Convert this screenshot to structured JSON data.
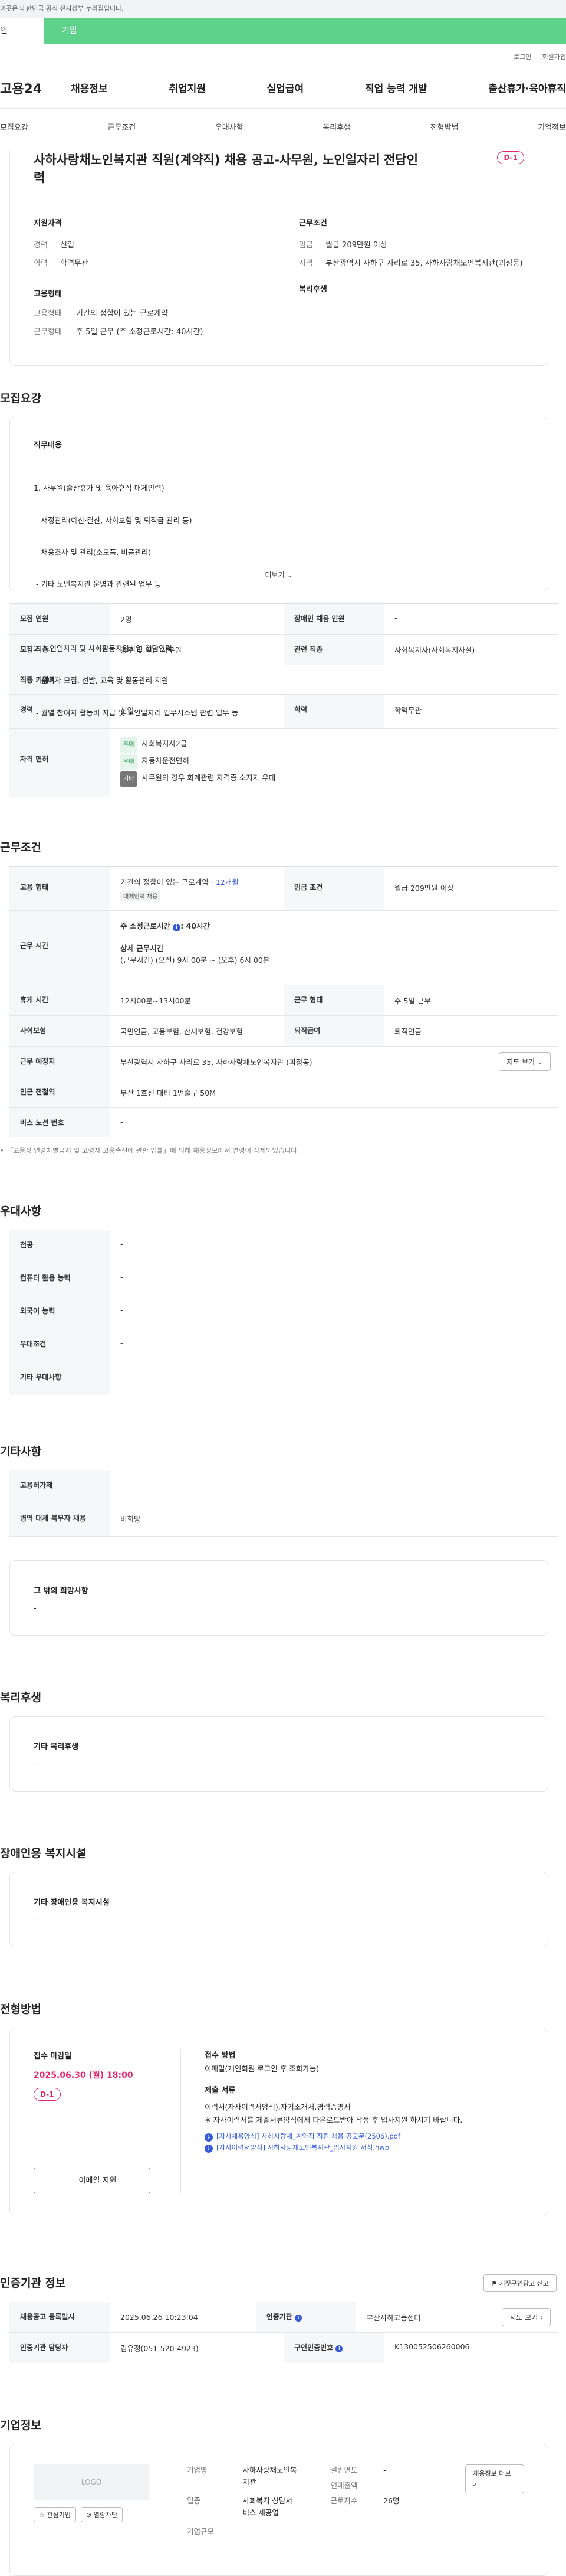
{
  "gov_banner": "이곳은 대한민국 공식 전자정부 누리집입니다.",
  "tabs": [
    "인",
    "기업"
  ],
  "util": [
    "로그인",
    "회원가입"
  ],
  "logo": "고용24",
  "gnb": [
    "채용정보",
    "취업지원",
    "실업급여",
    "직업 능력 개발",
    "출산휴가·육아휴직"
  ],
  "subnav": [
    "모집요강",
    "근무조건",
    "우대사항",
    "복리후생",
    "전형방법",
    "기업정보"
  ],
  "job": {
    "title_line1": "사하사랑채노인복지관 직원(계약직) 채용 공고-사무원, 노인일자리 전담인",
    "title_line2": "력",
    "dday": "D-1",
    "qual_title": "지원자격",
    "qual": [
      {
        "k": "경력",
        "v": "신입"
      },
      {
        "k": "학력",
        "v": "학력무관"
      }
    ],
    "cond_title": "근무조건",
    "cond": [
      {
        "k": "임금",
        "v": "월급 209만원 이상"
      },
      {
        "k": "지역",
        "v": "부산광역시 사하구 사리로 35, 사하사랑채노인복지관(괴정동)"
      }
    ],
    "emp_title": "고용형태",
    "emp": [
      {
        "k": "고용형태",
        "v": "기간의 정함이 있는 근로계약"
      },
      {
        "k": "근무형태",
        "v": "주 5일 근무 (주 소정근로시간: 40시간)"
      }
    ],
    "welfare_title": "복리후생"
  },
  "recruit": {
    "section": "모집요강",
    "duty_title": "직무내용",
    "duty_lines": [
      "1. 사무원(출산휴가 및 육아휴직 대체인력)",
      " - 재정관리(예산·결산, 사회보험 및 퇴직금 관리 등)",
      " - 채용조사 및 관리(소모품, 비품관리)",
      " - 기타 노인복지관 운영과 관련된 업무 등",
      "",
      "2. 노인일자리 및 사회활동지원사업 전담인력",
      " - 참여자 모집, 선발, 교육 및 활동관리 지원",
      " - 월별 참여자 활동비 지급 및 노인일자리 업무시스템 관련 업무 등"
    ],
    "more": "더보기",
    "rows": [
      {
        "h": "모집 인원",
        "v": "2명",
        "h2": "장애인 채용 인원",
        "v2": "-"
      },
      {
        "h": "모집 직종",
        "v": "총무 및 일반 사무원",
        "h2": "관련 직종",
        "v2": "사회복지사(사회복지사설)"
      },
      {
        "h": "직종 키워드",
        "v": "-"
      },
      {
        "h": "경력",
        "v": "신입",
        "h2": "학력",
        "v2": "학력무관"
      }
    ],
    "license_label": "자격 면허",
    "licenses": [
      {
        "tag": "우대",
        "name": "사회복지사2급"
      },
      {
        "tag": "우대",
        "name": "자동차운전면허"
      },
      {
        "tag": "기타",
        "name": "사무원의 경우 회계관련 자격증 소지자 우대"
      }
    ]
  },
  "work": {
    "section": "근무조건",
    "emp_h": "고용 형태",
    "emp_v": "기간의 정함이 있는 근로계약 · ",
    "emp_months": "12개월",
    "emp_tag": "대체인력 채용",
    "wage_h": "임금 조건",
    "wage_v": "월급 209만원 이상",
    "hours_h": "근무 시간",
    "hours_week": "주 소정근로시간",
    "hours_week_v": ": 40시간",
    "hours_detail_t": "상세 근무시간",
    "hours_detail_v": "(근무시간) (오전) 9시 00분 ~ (오후) 6시 00분",
    "break_h": "휴게 시간",
    "break_v": "12시00분~13시00분",
    "type_h": "근무 형태",
    "type_v": "주 5일 근무",
    "ins_h": "사회보험",
    "ins_v": "국민연금, 고용보험, 산재보험, 건강보험",
    "ret_h": "퇴직급여",
    "ret_v": "퇴직연금",
    "place_h": "근무 예정지",
    "place_v": "부산광역시 사하구 사리로 35, 사하사랑채노인복지관 (괴정동)",
    "map_btn": "지도 보기",
    "subway_h": "인근 전철역",
    "subway_v": "부산 1호선 대티 1번출구 50M",
    "bus_h": "버스 노선 번호",
    "bus_v": "-",
    "note": "• 「고용상 연령차별금지 및 고령자 고용촉진에 관한 법률」에 의해 채용정보에서 연령이 삭제되었습니다."
  },
  "pref": {
    "section": "우대사항",
    "rows": [
      {
        "h": "전공",
        "v": "-"
      },
      {
        "h": "컴퓨터 활용 능력",
        "v": "-"
      },
      {
        "h": "외국어 능력",
        "v": "-"
      },
      {
        "h": "우대조건",
        "v": "-"
      },
      {
        "h": "기타 우대사항",
        "v": "-"
      }
    ]
  },
  "etc": {
    "section": "기타사항",
    "rows": [
      {
        "h": "고용허가제",
        "v": "-"
      },
      {
        "h": "병역 대체 복무자 채용",
        "v": "비희망"
      }
    ],
    "box_title": "그 밖의 희망사항",
    "box_v": "-"
  },
  "welfare": {
    "section": "복리후생",
    "box_title": "기타 복리후생",
    "box_v": "-"
  },
  "disab": {
    "section": "장애인용 복지시설",
    "box_title": "기타 장애인용 복지시설",
    "box_v": "-"
  },
  "process": {
    "section": "전형방법",
    "deadline_t": "접수 마감일",
    "deadline_v": "2025.06.30 (월) 18:00",
    "dday": "D-1",
    "email_btn": "이메일 지원",
    "method_t": "접수 방법",
    "method_v": "이메일(개인회원 로그인 후 조회가능)",
    "docs_t": "제출 서류",
    "docs_v1": "이력서(자사이력서양식),자기소개서,경력증명서",
    "docs_v2": "※ 자사이력서를 제출서류양식에서 다운로드받아 작성 후 입사지원 하시기 바랍니다.",
    "file1": "[자사채용양식] 사하사랑채_계약직 직원 채용 공고문(2506).pdf",
    "file2": "[자사이력서양식] 사하사랑채노인복지관_입사지원 서식.hwp"
  },
  "agency": {
    "section": "인증기관 정보",
    "report_btn": "거짓구인광고 신고",
    "rows": [
      {
        "h": "채용공고 등록일시",
        "v": "2025.06.26 10:23:04",
        "h2": "인증기관",
        "v2": "부산사하고용센터",
        "btn": "지도 보기"
      },
      {
        "h": "인증기관 담당자",
        "v": "김유정(051-520-4923)",
        "h2": "구인인증번호",
        "v2": "K130052506260006"
      }
    ]
  },
  "company": {
    "section": "기업정보",
    "logo_placeholder": "LOGO",
    "fav_btn": "관심기업",
    "block_btn": "열람차단",
    "name_k": "기업명",
    "name_v1": "사하사랑채노인복",
    "name_v2": "지관",
    "ind_k": "업종",
    "ind_v1": "사회복지 상담서",
    "ind_v2": "비스 제공업",
    "scale_k": "기업규모",
    "scale_v": "-",
    "est_k": "설립연도",
    "est_v": "-",
    "rev_k": "연매출액",
    "rev_v": "-",
    "emp_k": "근로자수",
    "emp_v": "26명",
    "jobs_btn": "채용정보 더보기"
  }
}
